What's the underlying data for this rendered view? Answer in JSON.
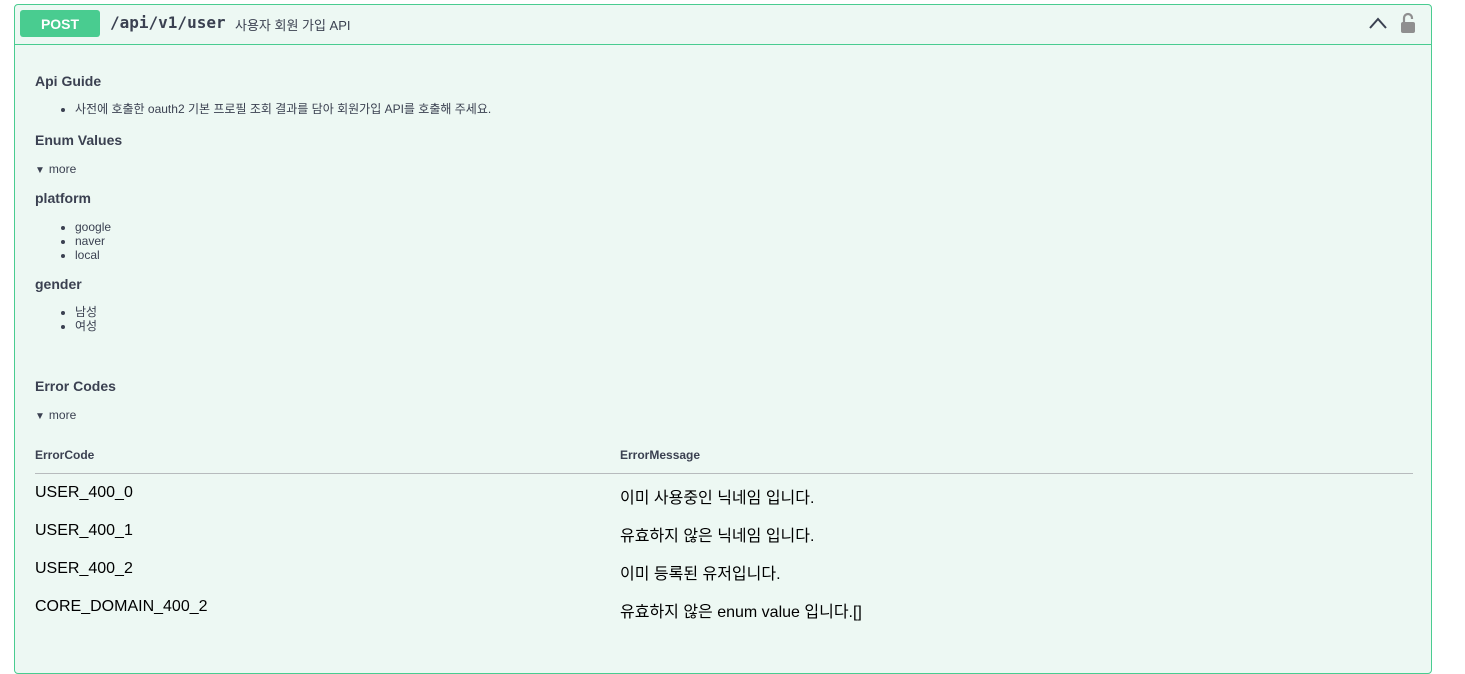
{
  "endpoint": {
    "method": "POST",
    "path": "/api/v1/user",
    "summary": "사용자 회원 가입 API",
    "accent_color": "#49cc90"
  },
  "icons": {
    "collapse": "chevron-up-icon",
    "auth": "lock-icon"
  },
  "api_guide": {
    "heading": "Api Guide",
    "items": [
      "사전에 호출한 oauth2 기본 프로필 조회 결과를 담아 회원가입 API를 호출해 주세요."
    ]
  },
  "enum_values": {
    "heading": "Enum Values",
    "toggle_label": "more",
    "groups": [
      {
        "name": "platform",
        "values": [
          "google",
          "naver",
          "local"
        ]
      },
      {
        "name": "gender",
        "values": [
          "남성",
          "여성"
        ]
      }
    ]
  },
  "error_codes": {
    "heading": "Error Codes",
    "toggle_label": "more",
    "columns": [
      "ErrorCode",
      "ErrorMessage"
    ],
    "rows": [
      {
        "code": "USER_400_0",
        "message": "이미 사용중인 닉네임 입니다."
      },
      {
        "code": "USER_400_1",
        "message": "유효하지 않은 닉네임 입니다."
      },
      {
        "code": "USER_400_2",
        "message": "이미 등록된 유저입니다."
      },
      {
        "code": "CORE_DOMAIN_400_2",
        "message": "유효하지 않은 enum value 입니다.[]"
      }
    ]
  }
}
